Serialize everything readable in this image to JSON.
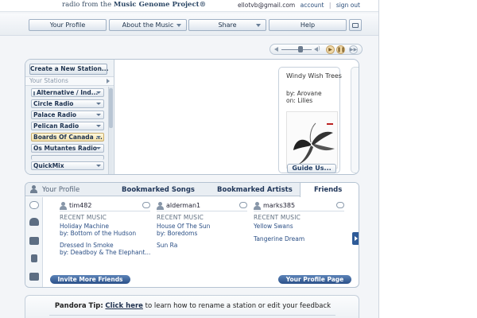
{
  "header": {
    "tagline_pre": "radio from the ",
    "tagline_brand": "Music Genome Project®",
    "email": "ellotvb@gmail.com",
    "account_link": "account",
    "separator": "|",
    "signout_link": "sign out"
  },
  "nav": {
    "items": [
      {
        "label": "Your Profile"
      },
      {
        "label": "About the Music"
      },
      {
        "label": "Share"
      },
      {
        "label": "Help"
      }
    ]
  },
  "stations": {
    "create_label": "Create a New Station...",
    "section_label": "Your Stations",
    "items": [
      {
        "label": "Alternative / Ind..."
      },
      {
        "label": "Circle Radio"
      },
      {
        "label": "Palace Radio"
      },
      {
        "label": "Pelican Radio"
      },
      {
        "label": "Boards Of Canada ..."
      },
      {
        "label": "Os Mutantes Radio"
      },
      {
        "label": "QuickMix"
      }
    ]
  },
  "now_playing": {
    "title": "Windy Wish Trees",
    "by": "by: Arovane",
    "on": "on: Lilies",
    "guide_label": "Guide Us..."
  },
  "profile": {
    "tabs": [
      {
        "label": "Your Profile"
      },
      {
        "label": "Bookmarked Songs"
      },
      {
        "label": "Bookmarked Artists"
      },
      {
        "label": "Friends"
      }
    ],
    "friends": [
      {
        "name": "tim482",
        "recent_label": "RECENT MUSIC",
        "lines": [
          "Holiday Machine",
          "by: Bottom of the Hudson",
          "Dressed In Smoke",
          "by: Deadboy & The Elephant..."
        ]
      },
      {
        "name": "alderman1",
        "recent_label": "RECENT MUSIC",
        "lines": [
          "House Of The Sun",
          "by: Boredoms",
          "Sun Ra"
        ]
      },
      {
        "name": "marks385",
        "recent_label": "RECENT MUSIC",
        "lines": [
          "Yellow Swans",
          "Tangerine Dream"
        ]
      }
    ],
    "invite_label": "Invite More Friends",
    "profile_page_label": "Your Profile Page"
  },
  "tip": {
    "title": "Pandora Tip:",
    "link": "Click here",
    "text": " to learn how to rename a station or edit your feedback"
  }
}
